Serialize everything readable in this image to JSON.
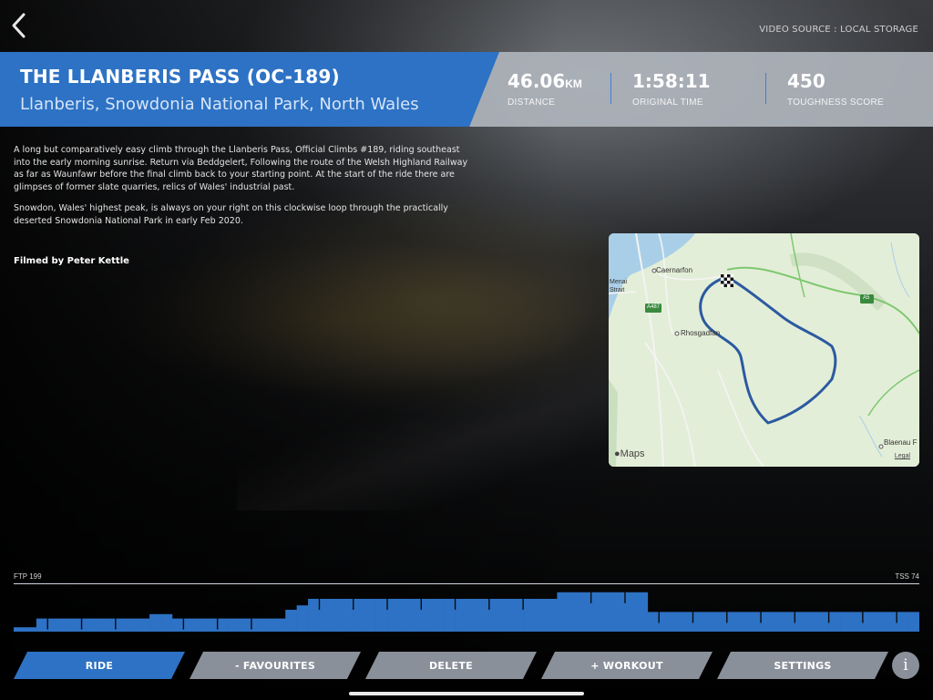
{
  "header": {
    "back_icon": "chevron-left-icon",
    "video_source": "VIDEO SOURCE : LOCAL STORAGE"
  },
  "ride": {
    "title": "THE LLANBERIS PASS (OC-189)",
    "location": "Llanberis, Snowdonia National Park, North Wales",
    "stats": {
      "distance": {
        "value": "46.06",
        "unit": "KM",
        "label": "DISTANCE"
      },
      "original_time": {
        "value": "1:58:11",
        "label": "ORIGINAL TIME"
      },
      "toughness": {
        "value": "450",
        "label": "TOUGHNESS SCORE"
      }
    },
    "description": [
      "A long but comparatively easy climb through the Llanberis Pass, Official Climbs #189, riding southeast into the early morning sunrise.  Return via Beddgelert, Following the route of the Welsh Highland Railway as far as Waunfawr before the final climb back to your starting point.  At the start of the ride there are glimpses of former slate quarries, relics of Wales' industrial past.",
      "Snowdon, Wales' highest peak, is always on your right on this clockwise loop through the practically deserted Snowdonia National Park in early Feb 2020."
    ],
    "filmed_by": "Filmed by Peter Kettle"
  },
  "map": {
    "labels": {
      "caernarfon": "Caernarfon",
      "menai": "Menai",
      "strait": "Strait",
      "rhosgadfan": "Rhosgadfan",
      "a487": "A487",
      "a5": "A5",
      "blaenau": "Blaenau F"
    },
    "attribution": "Maps",
    "legal": "Legal",
    "start_icon": "checkered-flag-icon",
    "apple_icon": "apple-logo-icon"
  },
  "profile": {
    "ftp_label": "FTP 199",
    "tss_label": "TSS 74",
    "color": "#2d72c4",
    "segment_levels": [
      0.1,
      0.1,
      0.3,
      0.3,
      0.3,
      0.3,
      0.3,
      0.3,
      0.3,
      0.3,
      0.3,
      0.3,
      0.4,
      0.4,
      0.3,
      0.3,
      0.3,
      0.3,
      0.3,
      0.3,
      0.3,
      0.3,
      0.3,
      0.3,
      0.5,
      0.6,
      0.75,
      0.75,
      0.75,
      0.75,
      0.75,
      0.75,
      0.75,
      0.75,
      0.75,
      0.75,
      0.75,
      0.75,
      0.75,
      0.75,
      0.75,
      0.75,
      0.75,
      0.75,
      0.75,
      0.75,
      0.75,
      0.75,
      0.9,
      0.9,
      0.9,
      0.9,
      0.9,
      0.9,
      0.9,
      0.9,
      0.45,
      0.45,
      0.45,
      0.45,
      0.45,
      0.45,
      0.45,
      0.45,
      0.45,
      0.45,
      0.45,
      0.45,
      0.45,
      0.45,
      0.45,
      0.45,
      0.45,
      0.45,
      0.45,
      0.45,
      0.45,
      0.45,
      0.45,
      0.45
    ]
  },
  "actions": {
    "ride": "RIDE",
    "favourites": "- FAVOURITES",
    "delete": "DELETE",
    "workout": "+ WORKOUT",
    "settings": "SETTINGS",
    "info": "i"
  },
  "colors": {
    "accent": "#2d72c4",
    "secondary_button": "#8a909a",
    "header_band": "#b4b8bf"
  }
}
